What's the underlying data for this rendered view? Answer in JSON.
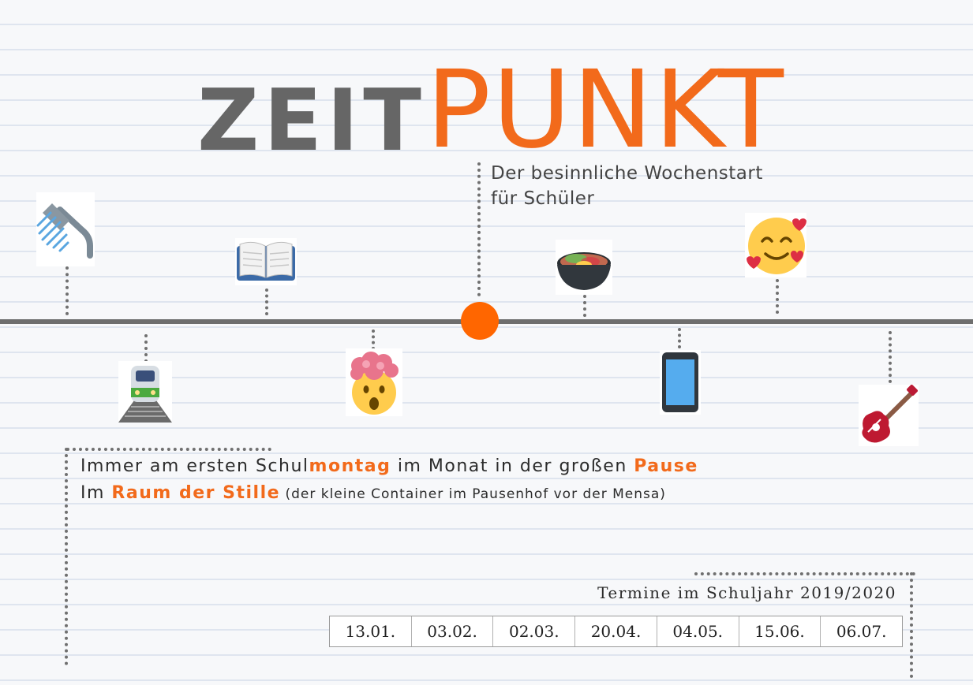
{
  "title": {
    "part1": "ZEIT",
    "part2": "PUNKT"
  },
  "subtitle": {
    "line1": "Der besinnliche Wochenstart",
    "line2": "für Schüler"
  },
  "colors": {
    "accent": "#f26a1b",
    "dark": "#666666",
    "timeline": "#6e6e6e",
    "dot": "#ff6600"
  },
  "timeline_icons": [
    {
      "name": "shower-icon",
      "position": "above"
    },
    {
      "name": "train-icon",
      "position": "below"
    },
    {
      "name": "open-book-icon",
      "position": "above"
    },
    {
      "name": "exploding-head-icon",
      "position": "below"
    },
    {
      "name": "bowl-with-food-icon",
      "position": "above"
    },
    {
      "name": "mobile-phone-icon",
      "position": "below"
    },
    {
      "name": "smiling-face-with-hearts-icon",
      "position": "above"
    },
    {
      "name": "guitar-icon",
      "position": "below"
    }
  ],
  "info": {
    "line1": {
      "a": "Immer am ersten Schul",
      "b": "montag",
      "c": " im Monat in der großen ",
      "d": "Pause"
    },
    "line2": {
      "a": "Im ",
      "b": "Raum der Stille",
      "c": " (der kleine Container im Pausenhof vor der Mensa)"
    }
  },
  "schedule": {
    "label": "Termine im Schuljahr 2019/2020",
    "dates": [
      "13.01.",
      "03.02.",
      "02.03.",
      "20.04.",
      "04.05.",
      "15.06.",
      "06.07."
    ]
  }
}
